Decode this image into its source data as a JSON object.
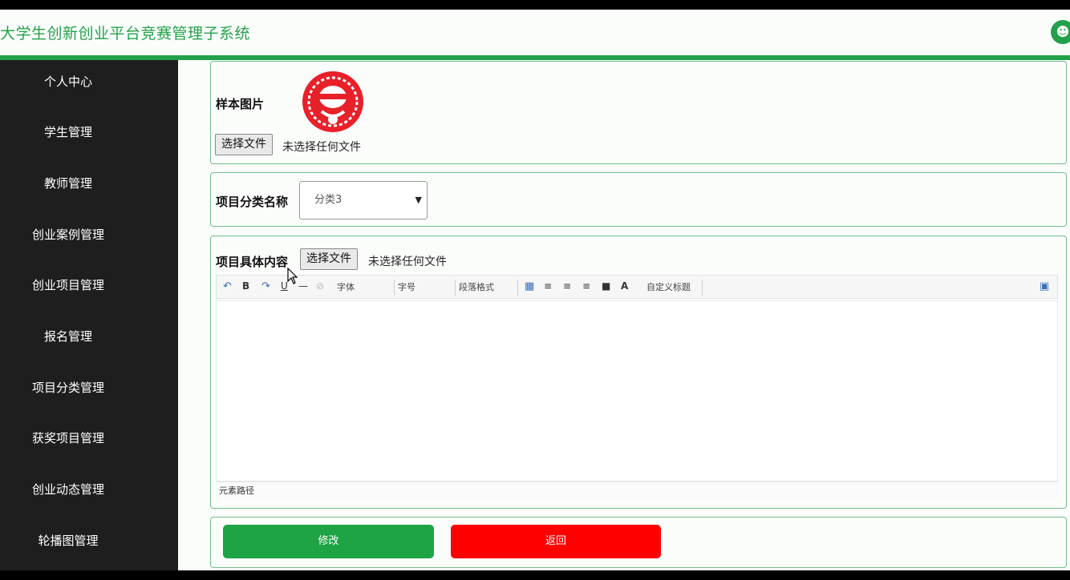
{
  "app": {
    "title": "大学生创新创业平台竞赛管理子系统",
    "user_icon": "user-icon",
    "accent": "#23a14a"
  },
  "sidebar": {
    "items": [
      {
        "label": "个人中心"
      },
      {
        "label": "学生管理"
      },
      {
        "label": "教师管理"
      },
      {
        "label": "创业案例管理"
      },
      {
        "label": "创业项目管理"
      },
      {
        "label": "报名管理"
      },
      {
        "label": "项目分类管理"
      },
      {
        "label": "获奖项目管理"
      },
      {
        "label": "创业动态管理"
      },
      {
        "label": "轮播图管理"
      }
    ]
  },
  "form": {
    "sample_image": {
      "label": "样本图片",
      "file_button": "选择文件",
      "file_status": "未选择任何文件"
    },
    "category": {
      "label": "项目分类名称",
      "selected": "分类3"
    },
    "content": {
      "label": "项目具体内容",
      "file_button": "选择文件",
      "file_status": "未选择任何文件",
      "toolbar": {
        "font_select": "字体",
        "size_select": "字号",
        "paragraph_select": "段落格式",
        "custom_title_select": "自定义标题",
        "bold": "B",
        "underline": "U",
        "font_color": "A"
      },
      "element_path": "元素路径"
    },
    "actions": {
      "modify": "修改",
      "back": "返回",
      "modify_color": "#1ea445",
      "back_color": "#ff0000"
    }
  }
}
